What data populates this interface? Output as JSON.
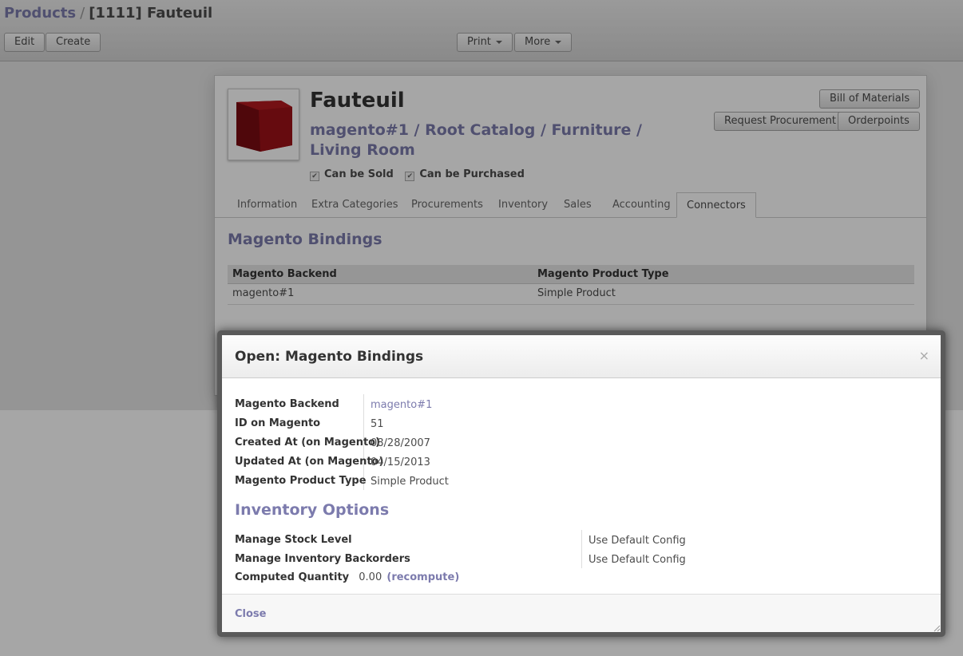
{
  "breadcrumb": {
    "parent": "Products",
    "separator": "/",
    "current": "[1111] Fauteuil"
  },
  "toolbar": {
    "edit": "Edit",
    "create": "Create",
    "print": "Print",
    "more": "More"
  },
  "product": {
    "name": "Fauteuil",
    "category": "magento#1 / Root Catalog / Furniture / Living Room",
    "can_be_sold": "Can be Sold",
    "can_be_purchased": "Can be Purchased",
    "image_color": "#a8161c"
  },
  "actions": {
    "bom": "Bill of Materials",
    "procurement": "Request Procurement",
    "orderpoints": "Orderpoints"
  },
  "tabs": [
    "Information",
    "Extra Categories",
    "Procurements",
    "Inventory",
    "Sales",
    "Accounting",
    "Connectors"
  ],
  "active_tab": "Connectors",
  "bindings": {
    "title": "Magento Bindings",
    "columns": [
      "Magento Backend",
      "Magento Product Type"
    ],
    "rows": [
      [
        "magento#1",
        "Simple Product"
      ]
    ]
  },
  "dialog": {
    "title": "Open: Magento Bindings",
    "close_x": "×",
    "fields": [
      {
        "label": "Magento Backend",
        "value": "magento#1"
      },
      {
        "label": "ID on Magento",
        "value": "51"
      },
      {
        "label": "Created At (on Magento)",
        "value": "08/28/2007"
      },
      {
        "label": "Updated At (on Magento)",
        "value": "04/15/2013"
      },
      {
        "label": "Magento Product Type",
        "value": "Simple Product"
      }
    ],
    "inventory_title": "Inventory Options",
    "inventory": [
      {
        "label": "Manage Stock Level",
        "value": "Use Default Config"
      },
      {
        "label": "Manage Inventory Backorders",
        "value": "Use Default Config"
      }
    ],
    "computed": {
      "label": "Computed Quantity",
      "value": "0.00",
      "action": "(recompute)"
    },
    "close": "Close"
  },
  "colors": {
    "accent": "#7c7bad"
  }
}
